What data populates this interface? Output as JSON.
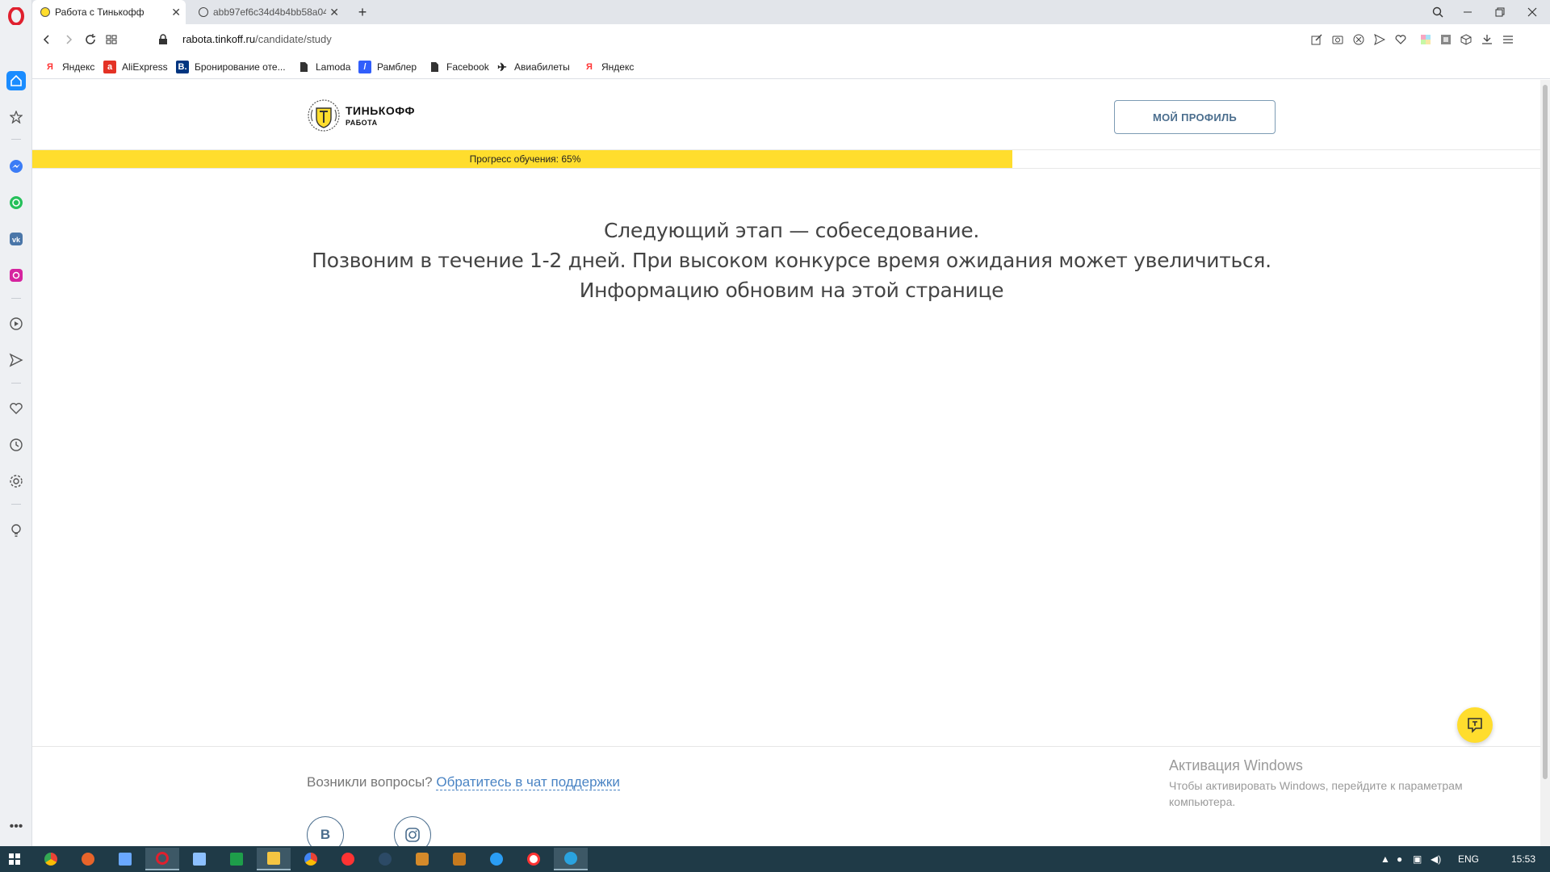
{
  "browser": {
    "tabs": [
      {
        "title": "Работа с Тинькофф",
        "active": true
      },
      {
        "title": "abb97ef6c34d4b4bb58a04",
        "active": false
      }
    ],
    "new_tab": "+",
    "url_host": "rabota.tinkoff.ru",
    "url_path": "/candidate/study"
  },
  "bookmarks": [
    {
      "label": "Яндекс",
      "icon": "yandex-icon"
    },
    {
      "label": "AliExpress",
      "icon": "aliexpress-icon"
    },
    {
      "label": "Бронирование оте...",
      "icon": "booking-icon"
    },
    {
      "label": "Lamoda",
      "icon": "page-icon"
    },
    {
      "label": "Рамблер",
      "icon": "rambler-icon"
    },
    {
      "label": "Facebook",
      "icon": "page-icon"
    },
    {
      "label": "Авиабилеты",
      "icon": "plane-icon"
    },
    {
      "label": "Яндекс",
      "icon": "yandex-icon"
    }
  ],
  "page": {
    "logo_brand": "ТИНЬКОФФ",
    "logo_sub": "РАБОТА",
    "profile_button": "МОЙ ПРОФИЛЬ",
    "progress_label": "Прогресс обучения: 65%",
    "progress_value": 0.65,
    "message_lines": [
      "Следующий этап — собеседование.",
      "Позвоним в течение 1-2 дней. При высоком конкурсе время ожидания может увеличиться.",
      "Информацию обновим на этой странице"
    ],
    "question_prefix": "Возникли вопросы?",
    "support_link": "Обратитесь в чат поддержки",
    "social_vk": "В"
  },
  "windows": {
    "activation_title": "Активация Windows",
    "activation_text": "Чтобы активировать Windows, перейдите к параметрам компьютера."
  },
  "taskbar": {
    "language": "ENG",
    "time": "15:53"
  },
  "colors": {
    "accent_yellow": "#ffdd2d",
    "button_border": "#7d9bb4",
    "link_blue": "#4a84c4",
    "taskbar": "#1f3a47",
    "opera_red": "#e0202e"
  }
}
